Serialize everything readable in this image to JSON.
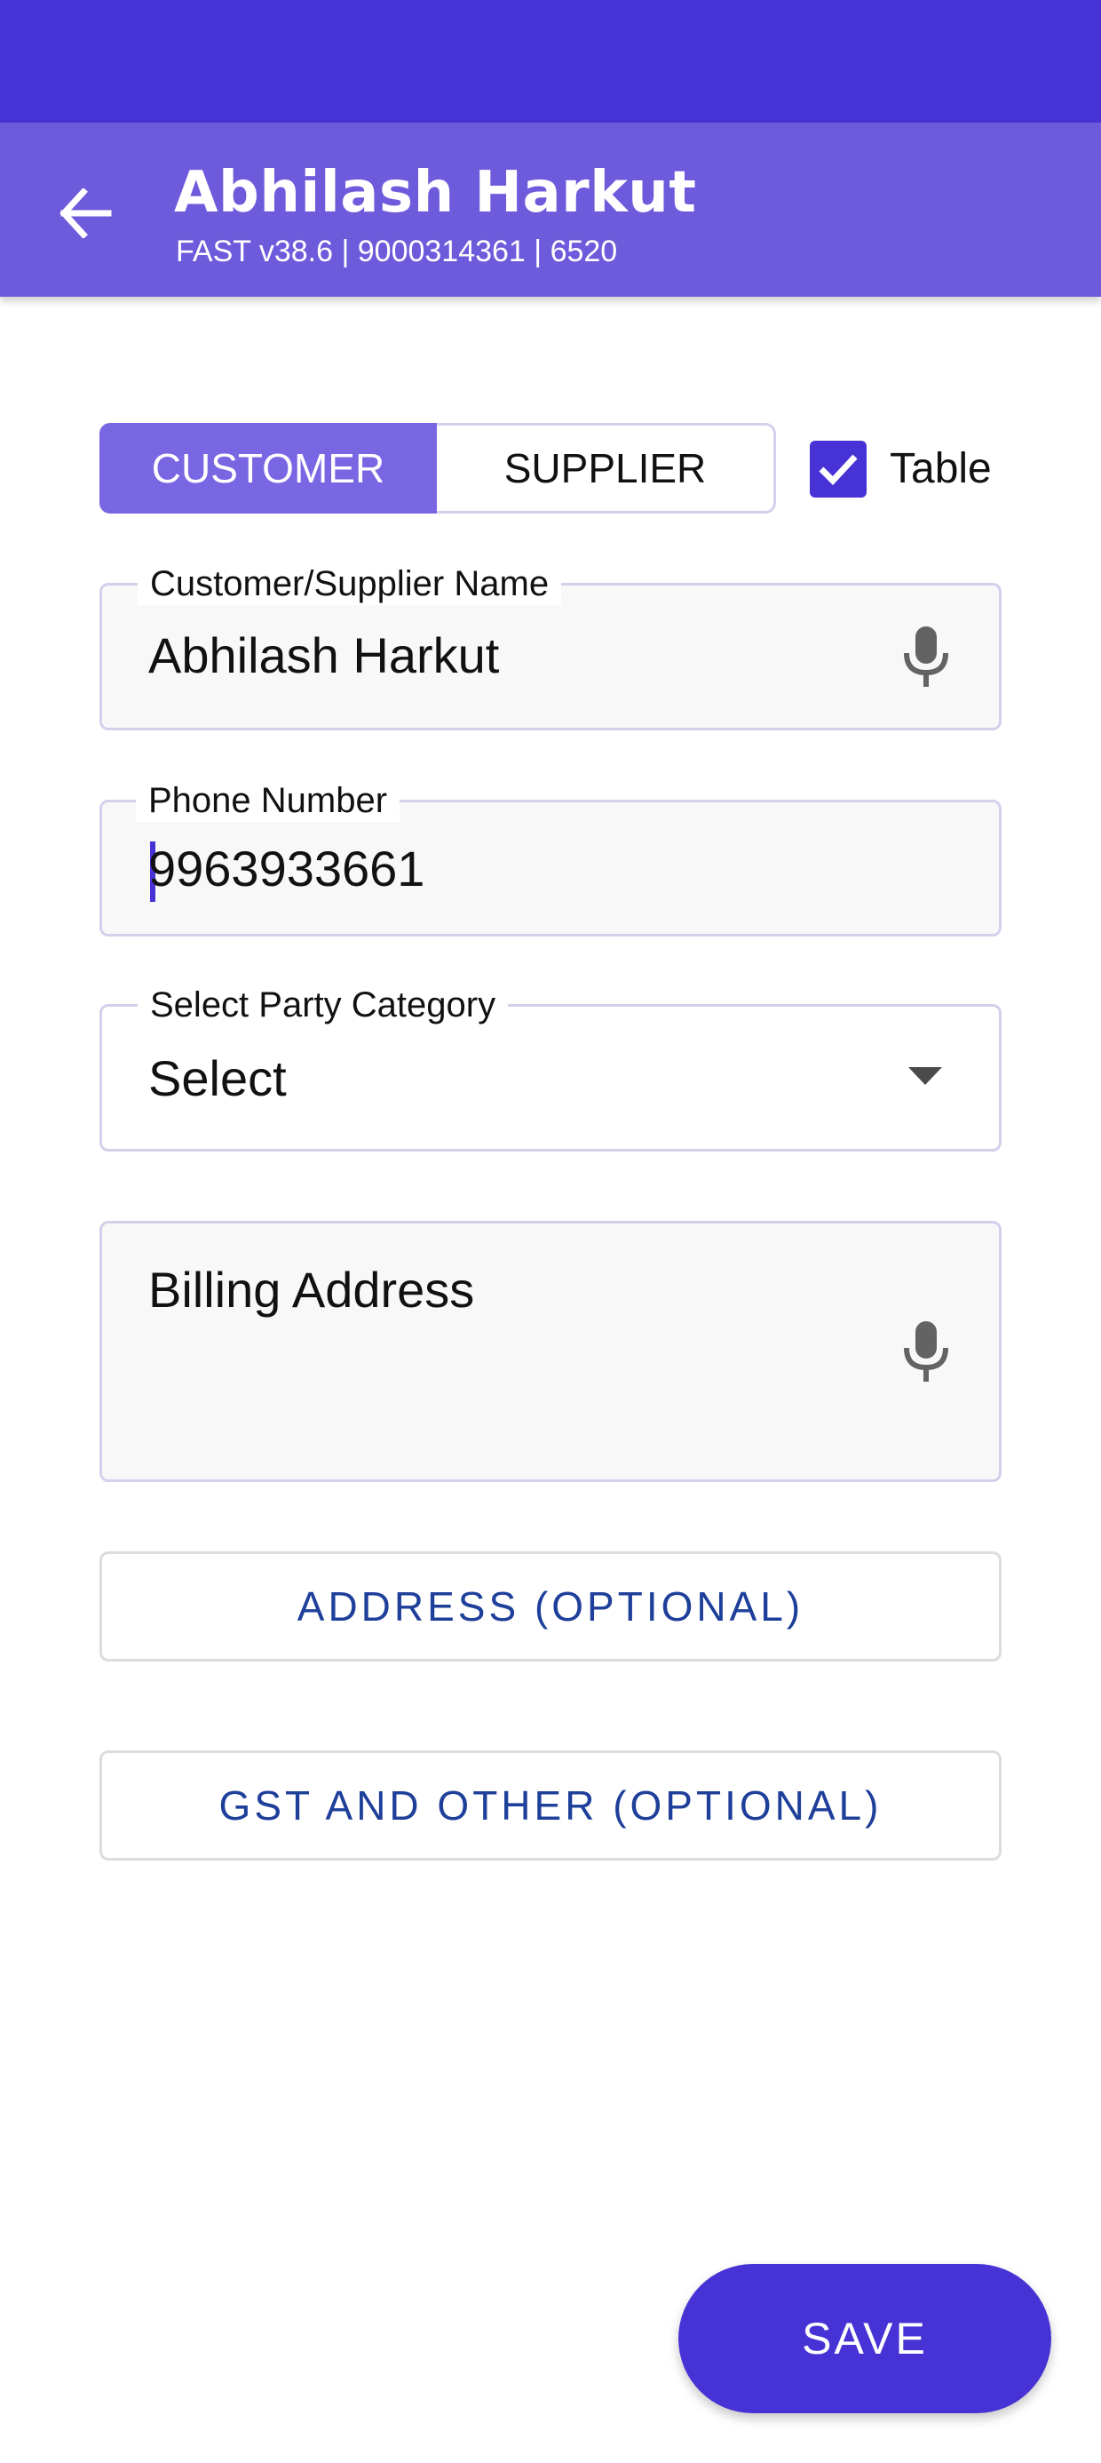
{
  "header": {
    "title": "Abhilash Harkut",
    "subtitle": "FAST v38.6 | 9000314361 | 6520",
    "back_icon": "arrow-left-icon"
  },
  "party_type": {
    "options": [
      "CUSTOMER",
      "SUPPLIER"
    ],
    "selected": "CUSTOMER",
    "table_label": "Table",
    "table_checked": true
  },
  "form": {
    "name": {
      "label": "Customer/Supplier Name",
      "value": "Abhilash Harkut",
      "icon": "microphone-icon"
    },
    "phone": {
      "label": "Phone Number",
      "value": "9963933661"
    },
    "category": {
      "label": "Select Party Category",
      "value": "Select",
      "icon": "dropdown-arrow-icon"
    },
    "billing": {
      "placeholder": "Billing Address",
      "icon": "microphone-icon"
    }
  },
  "buttons": {
    "address": "ADDRESS (OPTIONAL)",
    "gst": "GST AND OTHER (OPTIONAL)",
    "save": "SAVE"
  },
  "colors": {
    "status_bar": "#4733d5",
    "app_bar": "#6d5bdc",
    "accent": "#4733d5",
    "segment_selected": "#7866e3",
    "link_text": "#1e3f9a"
  }
}
